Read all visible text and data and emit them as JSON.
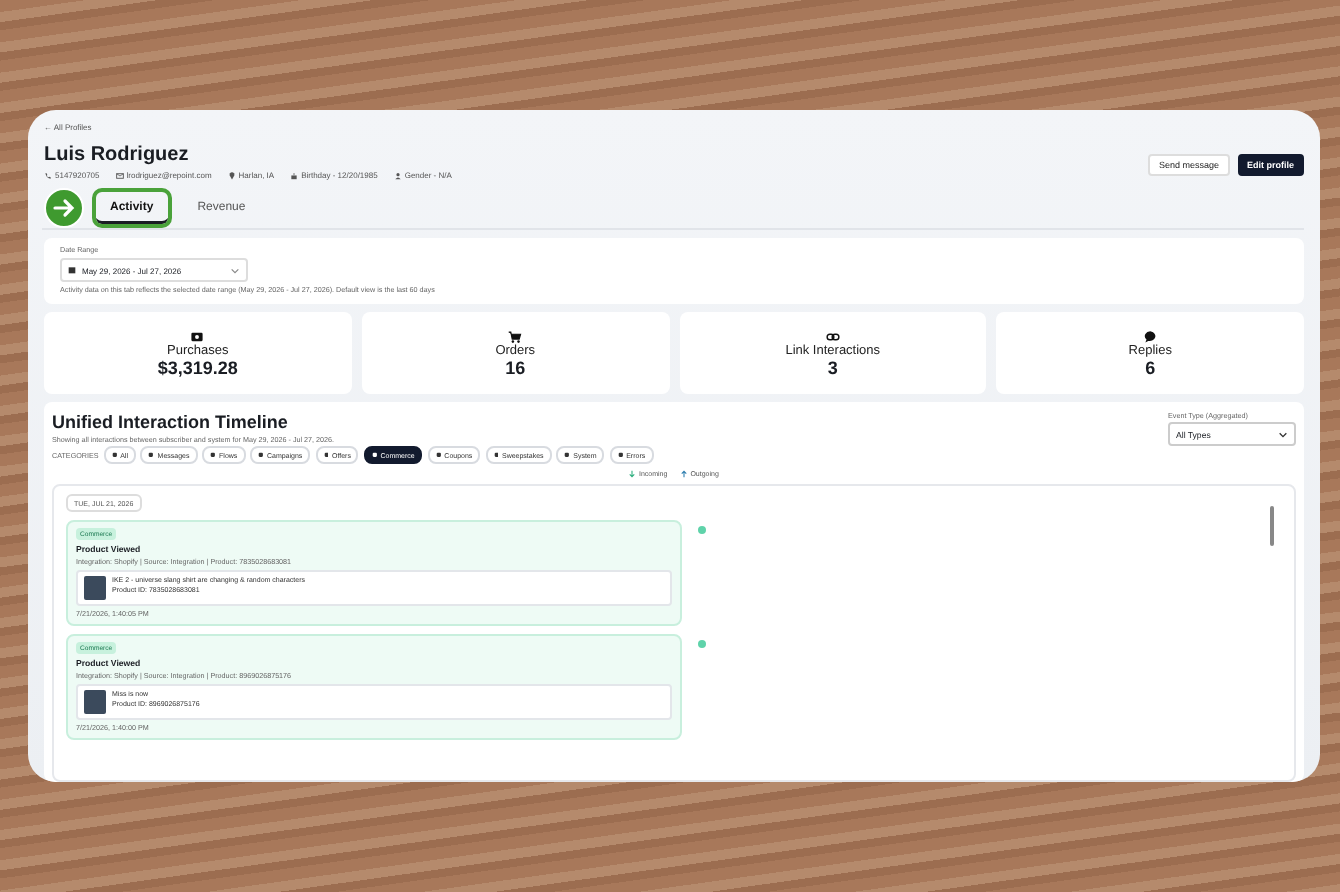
{
  "back_link": "← All Profiles",
  "profile": {
    "name": "Luis Rodriguez",
    "meta": [
      {
        "kind": "phone",
        "text": "5147920705"
      },
      {
        "kind": "email",
        "text": "lrodriguez@repoint.com"
      },
      {
        "kind": "location",
        "text": "Harlan, IA"
      },
      {
        "kind": "birthday",
        "text": "Birthday - 12/20/1985"
      },
      {
        "kind": "gender",
        "text": "Gender - N/A"
      }
    ]
  },
  "actions": [
    {
      "label": "Send message",
      "primary": false
    },
    {
      "label": "Edit profile",
      "primary": true
    }
  ],
  "tabs": [
    {
      "label": "Activity",
      "selected": true
    },
    {
      "label": "Revenue",
      "selected": false
    }
  ],
  "date_range": {
    "label": "Date Range",
    "value": "May 29, 2026 - Jul 27, 2026",
    "note": "Activity data on this tab reflects the selected date range (May 29, 2026 - Jul 27, 2026). Default view is the last 60 days"
  },
  "stats": [
    {
      "kind": "money",
      "label": "Purchases",
      "value": "$3,319.28"
    },
    {
      "kind": "cart",
      "label": "Orders",
      "value": "16"
    },
    {
      "kind": "link",
      "label": "Link Interactions",
      "value": "3"
    },
    {
      "kind": "chat",
      "label": "Replies",
      "value": "6"
    }
  ],
  "timeline": {
    "title": "Unified Interaction Timeline",
    "subtitle": "Showing all interactions between subscriber and system for May 29, 2026 - Jul 27, 2026.",
    "filter_label": "Event Type (Aggregated)",
    "filter_value": "All Types",
    "categories_label": "CATEGORIES",
    "categories": [
      {
        "label": "All",
        "selected": false
      },
      {
        "label": "Messages",
        "selected": false
      },
      {
        "label": "Flows",
        "selected": false
      },
      {
        "label": "Campaigns",
        "selected": false
      },
      {
        "label": "Offers",
        "selected": false
      },
      {
        "label": "Commerce",
        "selected": true
      },
      {
        "label": "Coupons",
        "selected": false
      },
      {
        "label": "Sweepstakes",
        "selected": false
      },
      {
        "label": "System",
        "selected": false
      },
      {
        "label": "Errors",
        "selected": false
      }
    ],
    "legend": [
      {
        "kind": "incoming",
        "label": "Incoming"
      },
      {
        "kind": "outgoing",
        "label": "Outgoing"
      }
    ],
    "date_chip": "TUE, JUL 21, 2026",
    "events": [
      {
        "badge": "Commerce",
        "title": "Product Viewed",
        "details": "Integration: Shopify | Source: Integration | Product: 7835028683081",
        "product_name": "IKE 2 - universe slang shirt are changing & random characters",
        "product_id": "Product ID: 7835028683081",
        "time": "7/21/2026, 1:40:05 PM"
      },
      {
        "badge": "Commerce",
        "title": "Product Viewed",
        "details": "Integration: Shopify | Source: Integration | Product: 8969026875176",
        "product_name": "Miss is now",
        "product_id": "Product ID: 8969026875176",
        "time": "7/21/2026, 1:40:00 PM"
      }
    ]
  }
}
